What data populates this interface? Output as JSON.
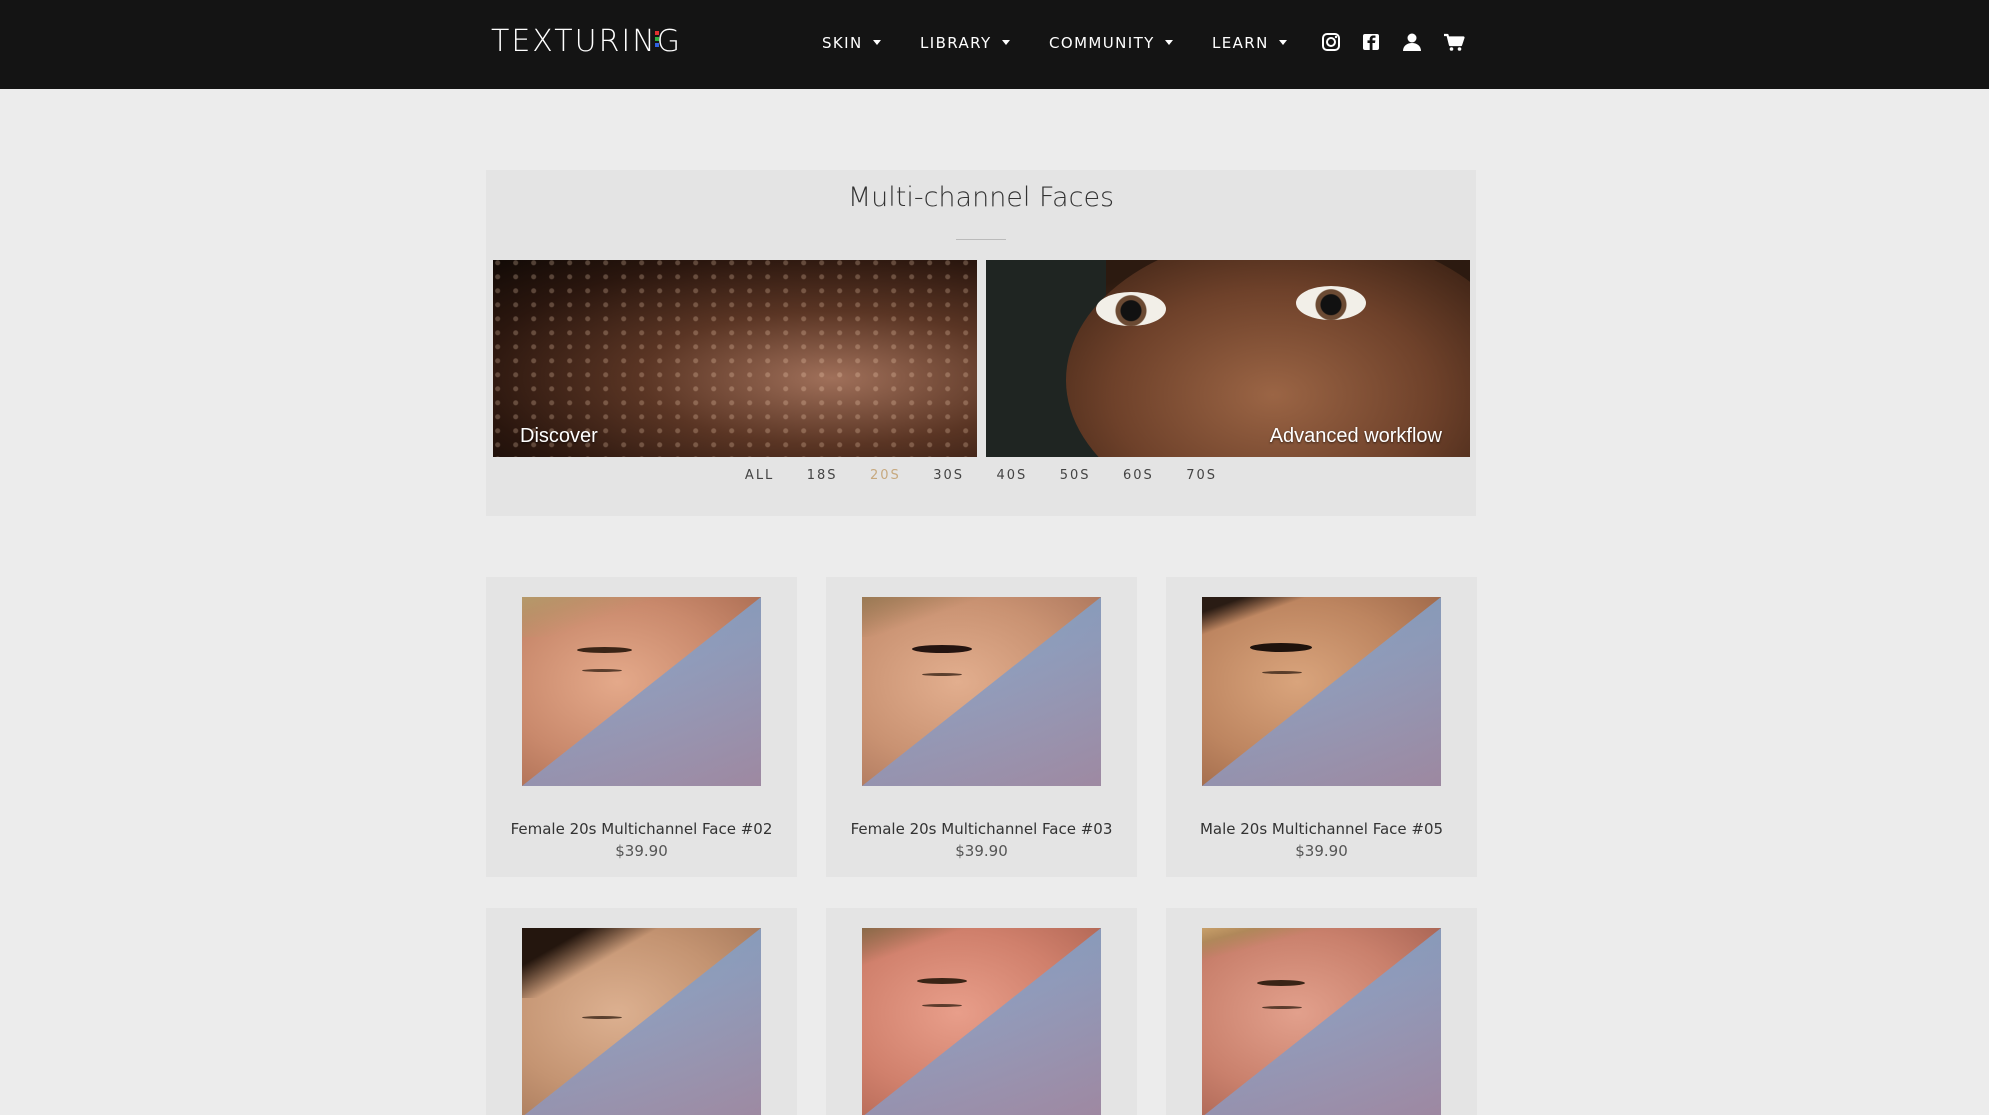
{
  "header": {
    "logo": "TEXTURING",
    "nav": [
      {
        "label": "SKIN"
      },
      {
        "label": "LIBRARY"
      },
      {
        "label": "COMMUNITY"
      },
      {
        "label": "LEARN"
      }
    ],
    "icons": [
      "instagram-icon",
      "facebook-icon",
      "account-icon",
      "cart-icon"
    ]
  },
  "collection": {
    "title": "Multi-channel Faces",
    "banners": [
      {
        "label": "Discover"
      },
      {
        "label": "Advanced workflow"
      }
    ],
    "filters": [
      {
        "label": "ALL",
        "active": false
      },
      {
        "label": "18S",
        "active": false
      },
      {
        "label": "20S",
        "active": true
      },
      {
        "label": "30S",
        "active": false
      },
      {
        "label": "40S",
        "active": false
      },
      {
        "label": "50S",
        "active": false
      },
      {
        "label": "60S",
        "active": false
      },
      {
        "label": "70S",
        "active": false
      }
    ]
  },
  "products": [
    {
      "name": "Female 20s Multichannel Face #02",
      "price": "$39.90"
    },
    {
      "name": "Female 20s Multichannel Face #03",
      "price": "$39.90"
    },
    {
      "name": "Male 20s Multichannel Face #05",
      "price": "$39.90"
    },
    {
      "name": "",
      "price": ""
    },
    {
      "name": "",
      "price": ""
    },
    {
      "name": "",
      "price": ""
    }
  ],
  "colors": {
    "header_bg": "#141414",
    "page_bg": "#ececec",
    "card_bg": "#e4e4e4",
    "active_filter": "#c7a97f"
  }
}
